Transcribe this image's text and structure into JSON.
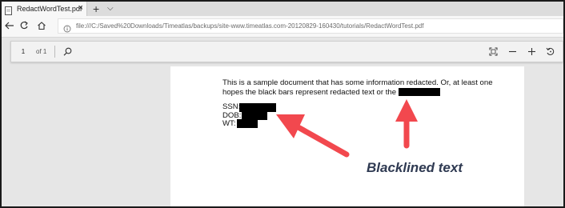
{
  "browser": {
    "tab": {
      "title": "RedactWordTest.pdf",
      "close_icon": "close-icon",
      "favicon": "pdf-file-icon"
    },
    "new_tab_icon": "plus-icon",
    "tab_menu_icon": "chevron-down-icon",
    "nav": {
      "back_icon": "back-arrow-icon",
      "refresh_icon": "refresh-icon",
      "home_icon": "home-icon"
    },
    "address": {
      "info_icon": "info-icon",
      "url": "file:///C:/Saved%20Downloads/Timeatlas/backups/site-www.timeatlas.com-20120829-160430/tutorials/RedactWordTest.pdf"
    }
  },
  "pdf_toolbar": {
    "page_number": "1",
    "page_count": "of 1",
    "search_icon": "search-icon",
    "fit_icon": "fit-to-page-icon",
    "zoom_out_icon": "minus-icon",
    "zoom_in_icon": "plus-icon",
    "rotate_icon": "rotate-icon"
  },
  "document": {
    "paragraph_line1": "This is a sample document that has some information redacted. Or, at least one",
    "paragraph_line2": "hopes the black bars represent redacted text or the",
    "fields": [
      {
        "label": "SSN:"
      },
      {
        "label": "DOB:"
      },
      {
        "label": "WT:"
      }
    ]
  },
  "annotation": {
    "callout_text": "Blacklined text",
    "arrow_color": "#f2484e",
    "callout_color": "#2f3a52"
  }
}
